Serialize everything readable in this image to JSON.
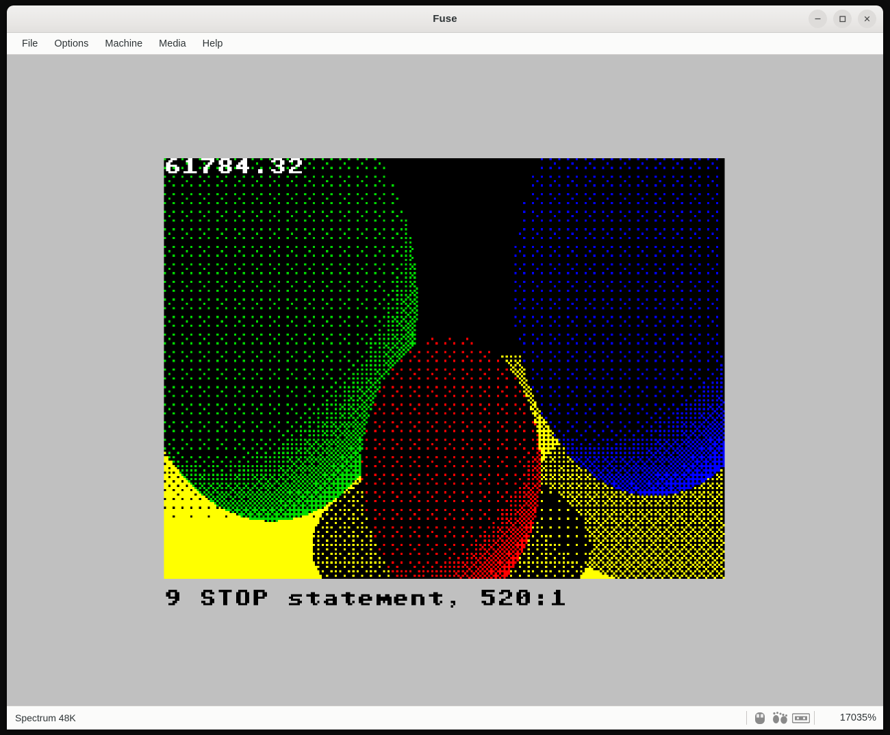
{
  "window": {
    "title": "Fuse",
    "controls": [
      {
        "name": "minimize-button",
        "icon": "minimize-icon",
        "label": "–"
      },
      {
        "name": "maximize-button",
        "icon": "maximize-icon",
        "label": "□"
      },
      {
        "name": "close-button",
        "icon": "close-icon",
        "label": "×"
      }
    ]
  },
  "menubar": {
    "items": [
      {
        "label": "File"
      },
      {
        "label": "Options"
      },
      {
        "label": "Machine"
      },
      {
        "label": "Media"
      },
      {
        "label": "Help"
      }
    ]
  },
  "screen": {
    "border_color": "#c0c0c0",
    "paper_color": "#000000",
    "top_text": "61784.32",
    "bottom_text": "9 STOP statement, 520:1",
    "top_text_color": "#ffffff",
    "bottom_text_color": "#000000",
    "palette": {
      "black": "#000000",
      "blue": "#0000ff",
      "red": "#ff0000",
      "green": "#00d800",
      "yellow": "#ffff00",
      "white": "#ffffff",
      "gray": "#c0c0c0"
    },
    "scene": {
      "description": "Dithered ray-traced spheres on a plane",
      "objects": [
        {
          "name": "green-sphere",
          "color": "#00d800",
          "cx": -0.62,
          "cy": 0.34,
          "r": 0.52
        },
        {
          "name": "blue-sphere",
          "color": "#0000ff",
          "cx": 0.74,
          "cy": 0.3,
          "r": 0.5
        },
        {
          "name": "red-sphere",
          "color": "#ff0000",
          "cx": 0.02,
          "cy": 0.74,
          "r": 0.32
        },
        {
          "name": "yellow-floor",
          "color": "#ffff00",
          "horizon": 0.46
        }
      ]
    }
  },
  "statusbar": {
    "machine": "Spectrum 48K",
    "icons": [
      {
        "name": "mouse-icon"
      },
      {
        "name": "microdrive-icon"
      },
      {
        "name": "tape-icon"
      }
    ],
    "speed": "17035%"
  }
}
